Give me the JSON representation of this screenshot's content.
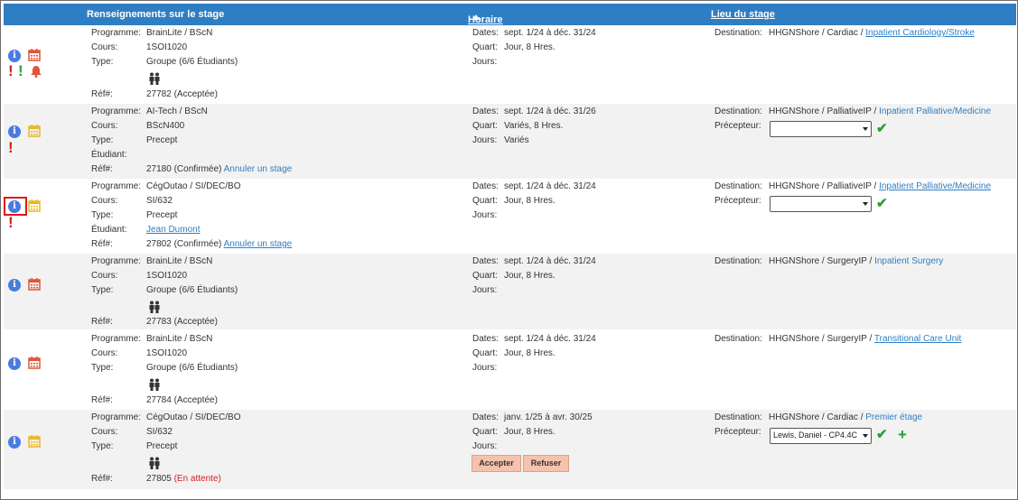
{
  "header": {
    "col1": "Renseignements sur le stage",
    "col2": "Horaire",
    "col3": "Lieu du stage"
  },
  "labels": {
    "programme": "Programme:",
    "cours": "Cours:",
    "type": "Type:",
    "etudiant": "Étudiant:",
    "ref": "Réf#:",
    "dates": "Dates:",
    "quart": "Quart:",
    "jours": "Jours:",
    "destination": "Destination:",
    "precepteur": "Précepteur:"
  },
  "colors": {
    "header_bg": "#2f7ec3",
    "alt_row": "#f2f2f2",
    "link": "#2f7ec3",
    "warning_red": "#d42020",
    "check_green": "#2b9e3a"
  },
  "rows": [
    {
      "programme": "BrainLite / BScN",
      "cours": "1SOI1020",
      "type": "Groupe (6/6 Étudiants)",
      "ref_num": "27782",
      "ref_status": "(Acceptée)",
      "dates": "sept. 1/24 à déc. 31/24",
      "quart": "Jour, 8 Hres.",
      "jours": "",
      "dest_prefix": "HHGNShore / Cardiac /",
      "dest_link": "Inpatient Cardiology/Stroke",
      "icons": [
        "info-icon",
        "calendar-icon",
        "exclamation-icon",
        "exclamation-icon",
        "bell-icon",
        "people-icon"
      ]
    },
    {
      "programme": "AI-Tech / BScN",
      "cours": "BScN400",
      "type": "Precept",
      "etudiant": "",
      "ref_num": "27180",
      "ref_status": "(Confirmée)",
      "ref_action": "Annuler un stage",
      "dates": "sept. 1/24 à déc. 31/26",
      "quart": "Variés, 8 Hres.",
      "jours": "Variés",
      "dest_prefix": "HHGNShore / PalliativeIP /",
      "dest_link": "Inpatient Palliative/Medicine",
      "precepteur_value": "",
      "icons": [
        "info-icon",
        "calendar-icon",
        "exclamation-icon",
        "checkmark-icon"
      ]
    },
    {
      "programme": "CégOutao / SI/DEC/BO",
      "cours": "SI/632",
      "type": "Precept",
      "etudiant": "Jean Dumont",
      "ref_num": "27802",
      "ref_status": "(Confirmée)",
      "ref_action": "Annuler un stage",
      "dates": "sept. 1/24 à déc. 31/24",
      "quart": "Jour, 8 Hres.",
      "jours": "",
      "dest_prefix": "HHGNShore / PalliativeIP /",
      "dest_link": "Inpatient Palliative/Medicine",
      "precepteur_value": "",
      "icons": [
        "info-icon",
        "calendar-icon",
        "exclamation-icon",
        "checkmark-icon"
      ]
    },
    {
      "programme": "BrainLite / BScN",
      "cours": "1SOI1020",
      "type": "Groupe (6/6 Étudiants)",
      "ref_num": "27783",
      "ref_status": "(Acceptée)",
      "dates": "sept. 1/24 à déc. 31/24",
      "quart": "Jour, 8 Hres.",
      "jours": "",
      "dest_prefix": "HHGNShore / SurgeryIP /",
      "dest_link": "Inpatient Surgery",
      "icons": [
        "info-icon",
        "calendar-icon",
        "people-icon"
      ]
    },
    {
      "programme": "BrainLite / BScN",
      "cours": "1SOI1020",
      "type": "Groupe (6/6 Étudiants)",
      "ref_num": "27784",
      "ref_status": "(Acceptée)",
      "dates": "sept. 1/24 à déc. 31/24",
      "quart": "Jour, 8 Hres.",
      "jours": "",
      "dest_prefix": "HHGNShore / SurgeryIP /",
      "dest_link": "Transitional Care Unit",
      "icons": [
        "info-icon",
        "calendar-icon",
        "people-icon"
      ]
    },
    {
      "programme": "CégOutao / SI/DEC/BO",
      "cours": "SI/632",
      "type": "Precept",
      "ref_num": "27805",
      "ref_status": "(En attente)",
      "dates": "janv. 1/25 à avr. 30/25",
      "quart": "Jour, 8 Hres.",
      "jours": "",
      "dest_prefix": "HHGNShore / Cardiac /",
      "dest_link": "Premier étage",
      "precepteur_value": "Lewis, Daniel - CP4.4C",
      "accept_label": "Accepter",
      "refuse_label": "Refuser",
      "icons": [
        "info-icon",
        "calendar-icon",
        "people-icon",
        "checkmark-icon",
        "plus-icon"
      ]
    }
  ]
}
